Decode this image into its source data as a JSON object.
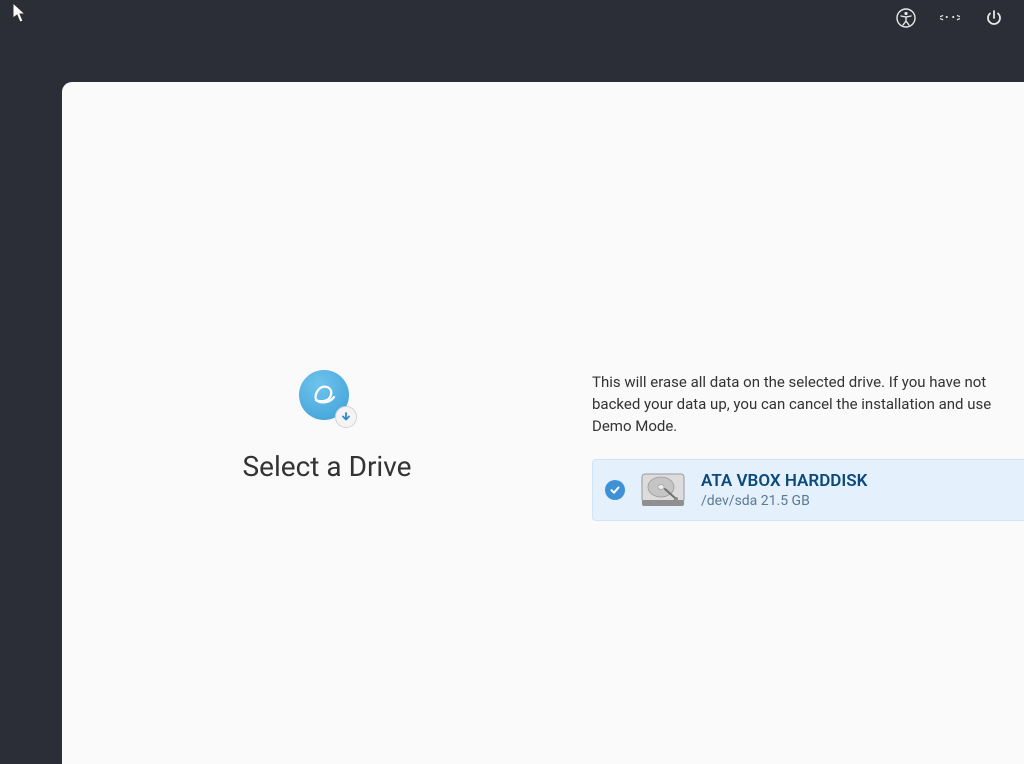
{
  "topbar": {
    "accessibility_icon": "accessibility",
    "network_icon": "wired-network",
    "power_icon": "power"
  },
  "installer": {
    "title": "Select a Drive",
    "warning": "This will erase all data on the selected drive. If you have not backed your data up, you can cancel the installation and use Demo Mode.",
    "drives": [
      {
        "name": "ATA VBOX HARDDISK",
        "subtitle": "/dev/sda 21.5 GB",
        "selected": true
      }
    ]
  }
}
